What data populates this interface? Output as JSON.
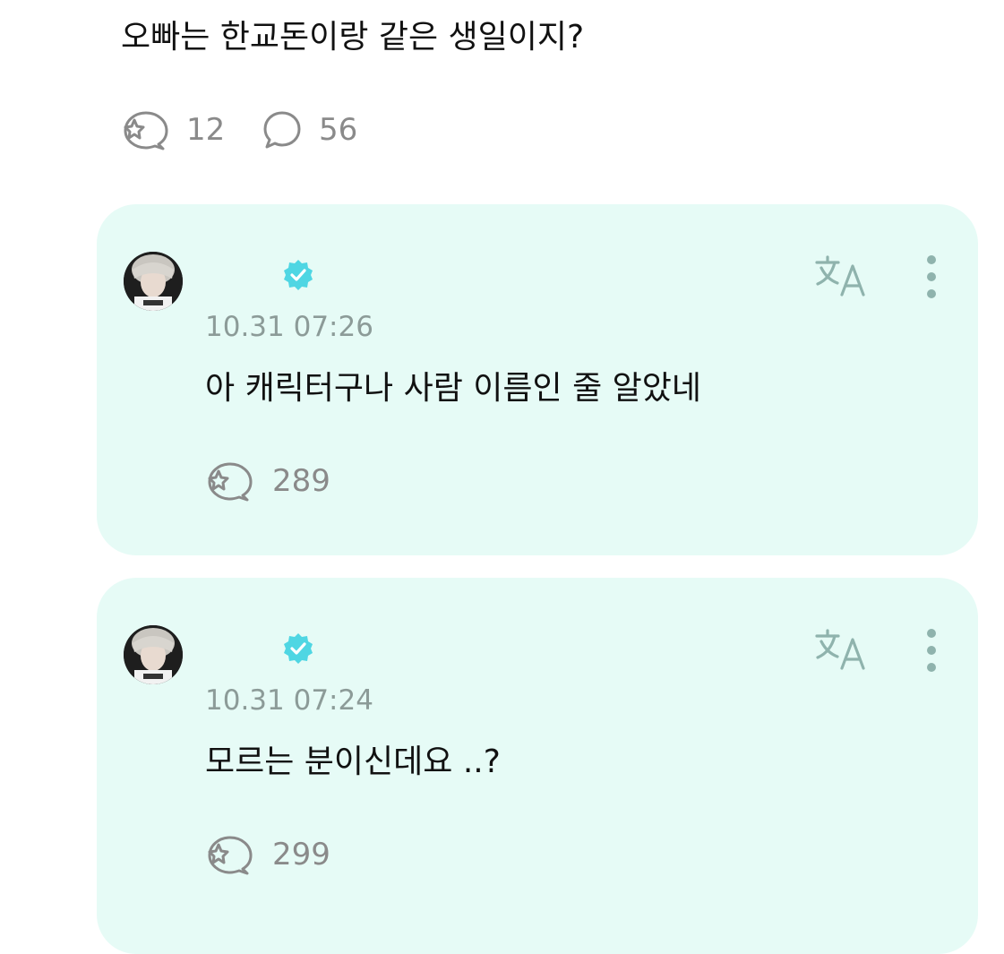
{
  "post": {
    "text": "오빠는 한교돈이랑 같은 생일이지?",
    "like_count": "12",
    "comment_count": "56"
  },
  "comments": [
    {
      "timestamp": "10.31 07:26",
      "text": "아 캐릭터구나 사람 이름인 줄 알았네",
      "like_count": "289"
    },
    {
      "timestamp": "10.31 07:24",
      "text": "모르는 분이신데요 ..?",
      "like_count": "299"
    }
  ],
  "colors": {
    "card_background": "#e6fbf6",
    "verified_badge": "#4fd6e3",
    "icon_gray": "#8a8a8a",
    "translate_icon": "#8fb3ad",
    "timestamp": "#8c9b98"
  },
  "icons": {
    "like": "star-bubble-icon",
    "comment": "speech-bubble-icon",
    "verified": "verified-badge-icon",
    "translate": "translate-icon",
    "more": "more-vertical-icon"
  }
}
